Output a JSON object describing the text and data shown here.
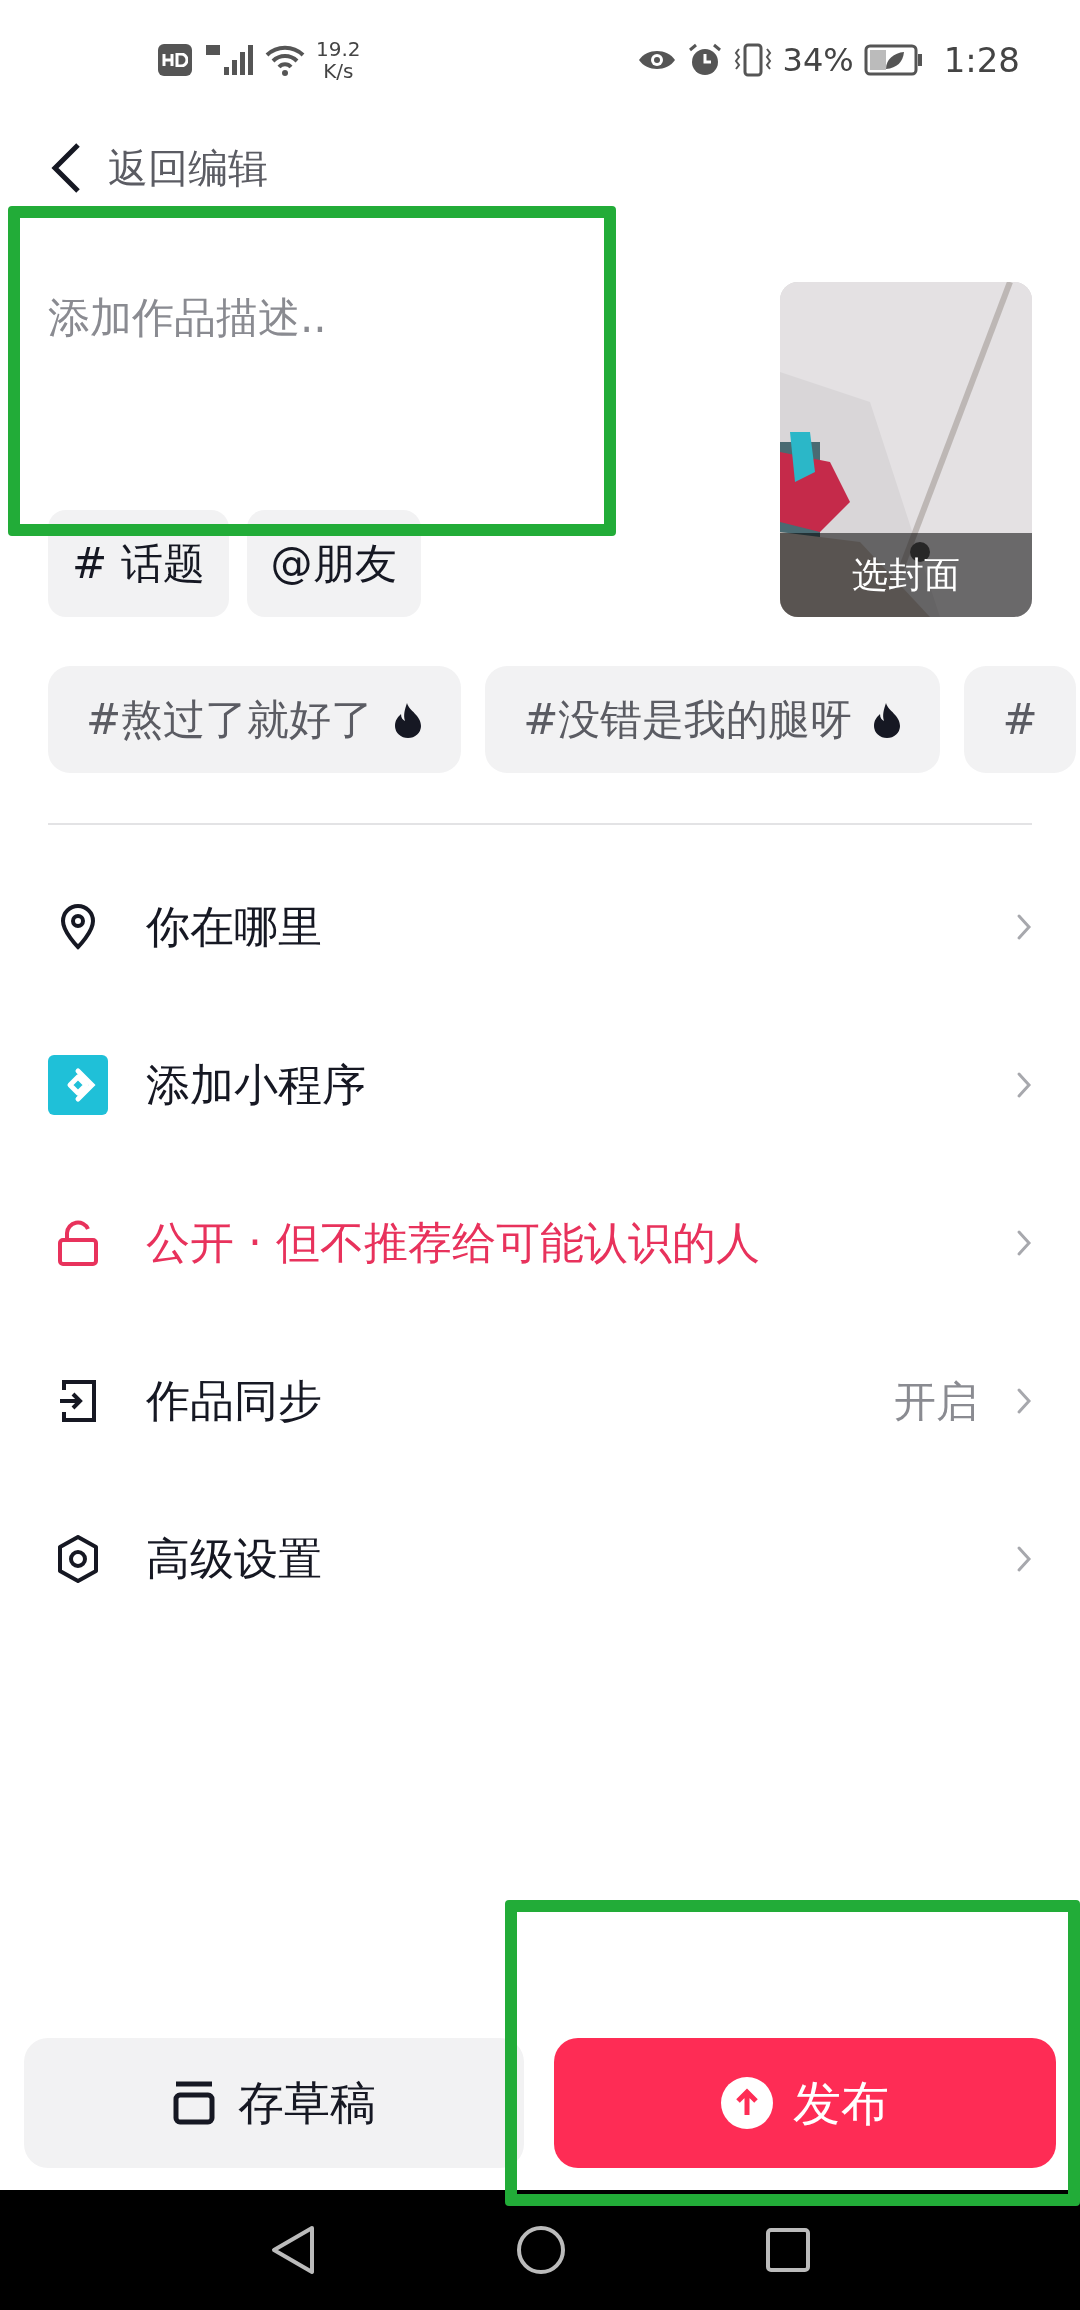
{
  "status_bar": {
    "speed": "19.2",
    "speed_unit": "K/s",
    "battery": "34%",
    "time": "1:28"
  },
  "header": {
    "back_label": "返回编辑"
  },
  "description": {
    "placeholder": "添加作品描述.."
  },
  "cover": {
    "label": "选封面"
  },
  "quick_chips": [
    {
      "label": "# 话题"
    },
    {
      "label": "@朋友"
    }
  ],
  "trending": [
    {
      "label": "#熬过了就好了",
      "hot": true
    },
    {
      "label": "#没错是我的腿呀",
      "hot": true
    },
    {
      "label": "#",
      "hot": false
    }
  ],
  "settings": [
    {
      "kind": "location",
      "label": "你在哪里"
    },
    {
      "kind": "miniapp",
      "label": "添加小程序"
    },
    {
      "kind": "privacy",
      "label": "公开 · 但不推荐给可能认识的人",
      "color": "#e8325c"
    },
    {
      "kind": "sync",
      "label": "作品同步",
      "value": "开启"
    },
    {
      "kind": "advanced",
      "label": "高级设置"
    }
  ],
  "footer": {
    "draft": "存草稿",
    "publish": "发布"
  }
}
